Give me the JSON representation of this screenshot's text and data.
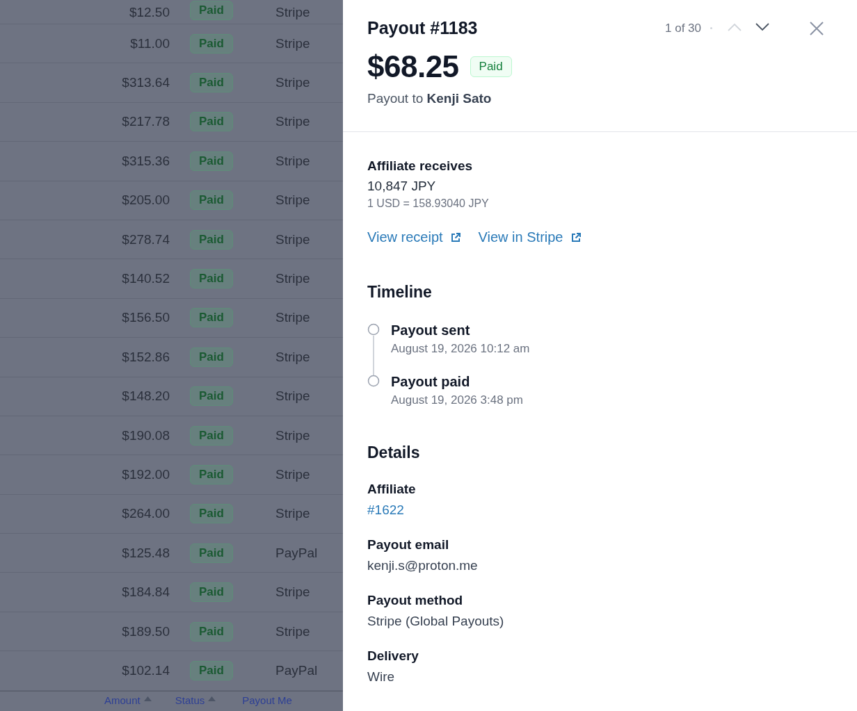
{
  "table": {
    "rows": [
      {
        "amount": "$12.50",
        "status": "Paid",
        "method": "Stripe"
      },
      {
        "amount": "$11.00",
        "status": "Paid",
        "method": "Stripe"
      },
      {
        "amount": "$313.64",
        "status": "Paid",
        "method": "Stripe"
      },
      {
        "amount": "$217.78",
        "status": "Paid",
        "method": "Stripe"
      },
      {
        "amount": "$315.36",
        "status": "Paid",
        "method": "Stripe"
      },
      {
        "amount": "$205.00",
        "status": "Paid",
        "method": "Stripe"
      },
      {
        "amount": "$278.74",
        "status": "Paid",
        "method": "Stripe"
      },
      {
        "amount": "$140.52",
        "status": "Paid",
        "method": "Stripe"
      },
      {
        "amount": "$156.50",
        "status": "Paid",
        "method": "Stripe"
      },
      {
        "amount": "$152.86",
        "status": "Paid",
        "method": "Stripe"
      },
      {
        "amount": "$148.20",
        "status": "Paid",
        "method": "Stripe"
      },
      {
        "amount": "$190.08",
        "status": "Paid",
        "method": "Stripe"
      },
      {
        "amount": "$192.00",
        "status": "Paid",
        "method": "Stripe"
      },
      {
        "amount": "$264.00",
        "status": "Paid",
        "method": "Stripe"
      },
      {
        "amount": "$125.48",
        "status": "Paid",
        "method": "PayPal"
      },
      {
        "amount": "$184.84",
        "status": "Paid",
        "method": "Stripe"
      },
      {
        "amount": "$189.50",
        "status": "Paid",
        "method": "Stripe"
      },
      {
        "amount": "$102.14",
        "status": "Paid",
        "method": "PayPal"
      }
    ],
    "columns": [
      {
        "label": "Amount",
        "sortable": true
      },
      {
        "label": "Status",
        "sortable": true
      },
      {
        "label": "Payout Me",
        "sortable": false
      }
    ]
  },
  "panel": {
    "title": "Payout #1183",
    "position": "1 of 30",
    "previous_disabled": true,
    "next_disabled": false,
    "amount": "$68.25",
    "status": "Paid",
    "recipient": "Payout to **Kenji Sato**",
    "receives": {
      "heading": "Affiliate receives",
      "value": "10,847 JPY",
      "rate": "1 USD = 158.93040 JPY"
    },
    "links": [
      "View receipt",
      "View in Stripe"
    ],
    "timeline": {
      "heading": "Timeline",
      "events": [
        {
          "title": "Payout sent",
          "time": "August 19, 2026 10:12 am"
        },
        {
          "title": "Payout paid",
          "time": "August 19, 2026 3:48 pm"
        }
      ]
    },
    "details": {
      "heading": "Details",
      "fields": [
        {
          "label": "Affiliate",
          "value": "#1622",
          "kind": "link"
        },
        {
          "label": "Payout email",
          "value": "kenji.s@proton.me",
          "kind": "text"
        },
        {
          "label": "Payout method",
          "value": "Stripe (Global Payouts)",
          "kind": "text"
        },
        {
          "label": "Delivery",
          "value": "Wire",
          "kind": "text"
        }
      ]
    }
  }
}
